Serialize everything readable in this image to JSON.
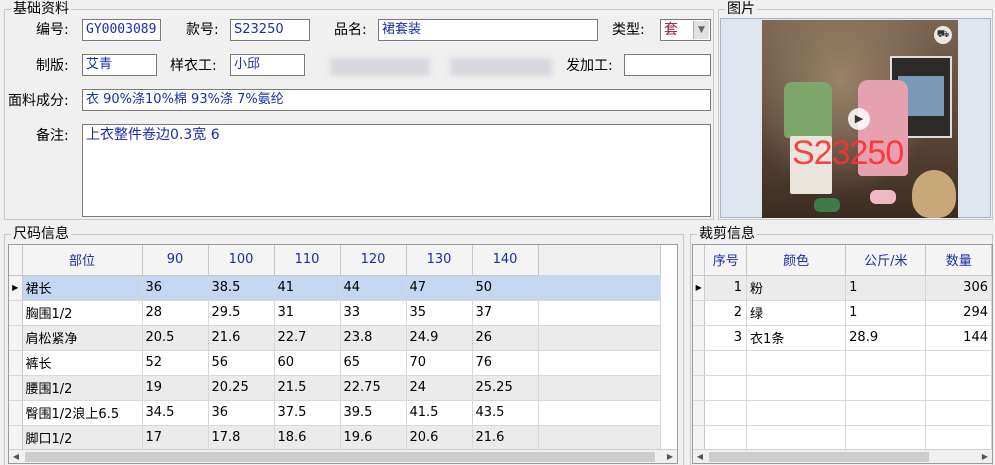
{
  "basic": {
    "group_title": "基础资料",
    "code_label": "编号:",
    "code_value": "GY0003089",
    "style_label": "款号:",
    "style_value": "S23250",
    "name_label": "品名:",
    "name_value": "裙套装",
    "type_label": "类型:",
    "type_value": "套",
    "maker_label": "制版:",
    "maker_value": "艾青",
    "sample_label": "样衣工:",
    "sample_value": "小邱",
    "outsource_label": "发加工:",
    "outsource_value": "",
    "fabric_label": "面料成分:",
    "fabric_value": "衣  90%涤10%棉  93%涤  7%氨纶",
    "note_label": "备注:",
    "note_value": "上衣整件卷边0.3宽    6"
  },
  "picture": {
    "group_title": "图片",
    "overlay_text": "S23250"
  },
  "size": {
    "group_title": "尺码信息",
    "headers": [
      "部位",
      "90",
      "100",
      "110",
      "120",
      "130",
      "140"
    ],
    "rows": [
      [
        "裙长",
        "36",
        "38.5",
        "41",
        "44",
        "47",
        "50"
      ],
      [
        "胸围1/2",
        "28",
        "29.5",
        "31",
        "33",
        "35",
        "37"
      ],
      [
        "肩松紧净",
        "20.5",
        "21.6",
        "22.7",
        "23.8",
        "24.9",
        "26"
      ],
      [
        "裤长",
        "52",
        "56",
        "60",
        "65",
        "70",
        "76"
      ],
      [
        "腰围1/2",
        "19",
        "20.25",
        "21.5",
        "22.75",
        "24",
        "25.25"
      ],
      [
        "臀围1/2浪上6.5",
        "34.5",
        "36",
        "37.5",
        "39.5",
        "41.5",
        "43.5"
      ],
      [
        "脚口1/2",
        "17",
        "17.8",
        "18.6",
        "19.6",
        "20.6",
        "21.6"
      ]
    ]
  },
  "cut": {
    "group_title": "裁剪信息",
    "headers": [
      "序号",
      "颜色",
      "公斤/米",
      "数量"
    ],
    "rows": [
      [
        "1",
        "粉",
        "1",
        "306"
      ],
      [
        "2",
        "绿",
        "1",
        "294"
      ],
      [
        "3",
        "衣1条",
        "28.9",
        "144"
      ]
    ]
  }
}
